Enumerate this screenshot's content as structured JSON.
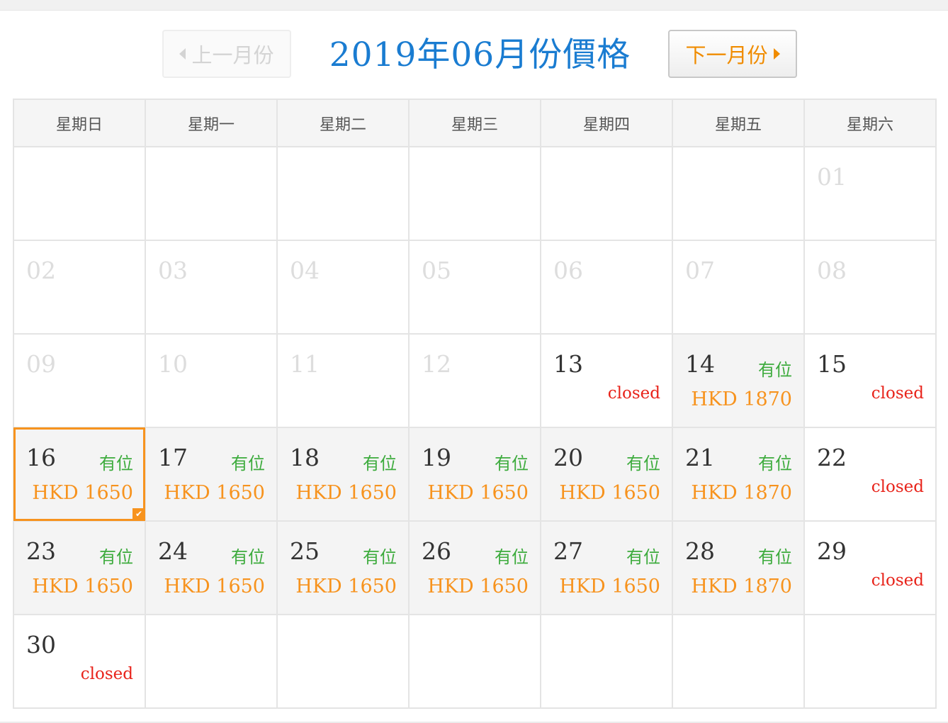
{
  "nav": {
    "prev_label": "上一月份",
    "next_label": "下一月份",
    "title": "2019年06月份價格"
  },
  "weekdays": [
    "星期日",
    "星期一",
    "星期二",
    "星期三",
    "星期四",
    "星期五",
    "星期六"
  ],
  "colors": {
    "title": "#1a7cd1",
    "available": "#3dab3d",
    "price": "#f7931e",
    "closed": "#e8231a",
    "selected_border": "#f7931e"
  },
  "weeks": [
    [
      {},
      {},
      {},
      {},
      {},
      {},
      {
        "day": "01",
        "past": true
      }
    ],
    [
      {
        "day": "02",
        "past": true
      },
      {
        "day": "03",
        "past": true
      },
      {
        "day": "04",
        "past": true
      },
      {
        "day": "05",
        "past": true
      },
      {
        "day": "06",
        "past": true
      },
      {
        "day": "07",
        "past": true
      },
      {
        "day": "08",
        "past": true
      }
    ],
    [
      {
        "day": "09",
        "past": true
      },
      {
        "day": "10",
        "past": true
      },
      {
        "day": "11",
        "past": true
      },
      {
        "day": "12",
        "past": true
      },
      {
        "day": "13",
        "closed": "closed"
      },
      {
        "day": "14",
        "status": "有位",
        "price": "HKD 1870"
      },
      {
        "day": "15",
        "closed": "closed"
      }
    ],
    [
      {
        "day": "16",
        "status": "有位",
        "price": "HKD 1650",
        "selected": true
      },
      {
        "day": "17",
        "status": "有位",
        "price": "HKD 1650"
      },
      {
        "day": "18",
        "status": "有位",
        "price": "HKD 1650"
      },
      {
        "day": "19",
        "status": "有位",
        "price": "HKD 1650"
      },
      {
        "day": "20",
        "status": "有位",
        "price": "HKD 1650"
      },
      {
        "day": "21",
        "status": "有位",
        "price": "HKD 1870"
      },
      {
        "day": "22",
        "closed": "closed"
      }
    ],
    [
      {
        "day": "23",
        "status": "有位",
        "price": "HKD 1650"
      },
      {
        "day": "24",
        "status": "有位",
        "price": "HKD 1650"
      },
      {
        "day": "25",
        "status": "有位",
        "price": "HKD 1650"
      },
      {
        "day": "26",
        "status": "有位",
        "price": "HKD 1650"
      },
      {
        "day": "27",
        "status": "有位",
        "price": "HKD 1650"
      },
      {
        "day": "28",
        "status": "有位",
        "price": "HKD 1870"
      },
      {
        "day": "29",
        "closed": "closed"
      }
    ],
    [
      {
        "day": "30",
        "closed": "closed"
      },
      {},
      {},
      {},
      {},
      {},
      {}
    ]
  ]
}
